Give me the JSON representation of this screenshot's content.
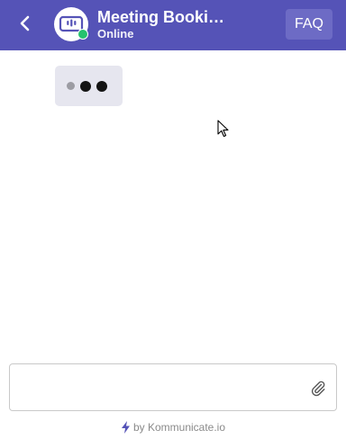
{
  "colors": {
    "header_bg": "#5553b7",
    "faq_bg": "#6d6bc5",
    "status_online": "#25c26e",
    "typing_bubble_bg": "#e6e6ef",
    "typing_dot_light": "#9c9ca3",
    "typing_dot_dark": "#141414",
    "brand_bolt": "#5553b7"
  },
  "header": {
    "back_icon": "chevron-left-icon",
    "avatar_icon": "chat-bubble-icon",
    "title": "Meeting Booking Bot",
    "status": "Online",
    "faq_label": "FAQ"
  },
  "chat": {
    "typing_indicator": true
  },
  "composer": {
    "value": "",
    "placeholder": "",
    "attach_icon": "paperclip-icon"
  },
  "footer": {
    "brand_icon": "lightning-bolt-icon",
    "powered_text": "by Kommunicate.io"
  }
}
